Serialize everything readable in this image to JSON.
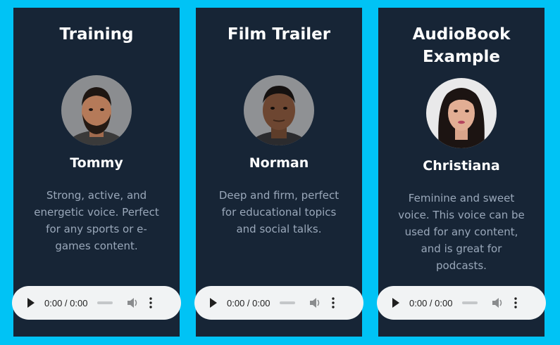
{
  "cards": [
    {
      "title": "Training",
      "name": "Tommy",
      "description": "Strong, active, and energetic voice. Perfect for any sports or e-games content.",
      "avatar_icon": "avatar-tommy",
      "player": {
        "time": "0:00 / 0:00"
      }
    },
    {
      "title": "Film Trailer",
      "name": "Norman",
      "description": "Deep and firm, perfect for educational topics and social talks.",
      "avatar_icon": "avatar-norman",
      "player": {
        "time": "0:00 / 0:00"
      }
    },
    {
      "title": "AudioBook Example",
      "name": "Christiana",
      "description": "Feminine and sweet voice. This voice can be used for any content, and is great for podcasts.",
      "avatar_icon": "avatar-christiana",
      "player": {
        "time": "0:00 / 0:00"
      }
    }
  ],
  "colors": {
    "page_background": "#00c3f5",
    "card_background": "#172536",
    "description_text": "#9aa8ba",
    "player_background": "#f1f3f4"
  }
}
